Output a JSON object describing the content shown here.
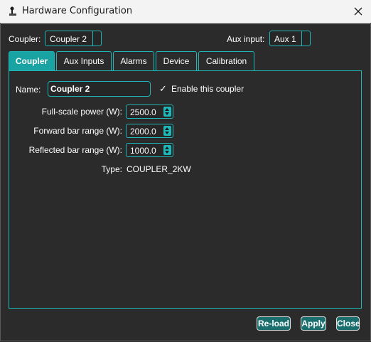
{
  "window": {
    "title": "Hardware Configuration",
    "app_icon": "app-icon",
    "close_icon": "close-icon"
  },
  "header": {
    "coupler_label": "Coupler:",
    "coupler_value": "Coupler 2",
    "aux_label": "Aux input:",
    "aux_value": "Aux 1"
  },
  "tabs": [
    {
      "label": "Coupler",
      "active": true
    },
    {
      "label": "Aux Inputs"
    },
    {
      "label": "Alarms"
    },
    {
      "label": "Device"
    },
    {
      "label": "Calibration"
    }
  ],
  "coupler_tab": {
    "name_label": "Name:",
    "name_value": "Coupler 2",
    "enable_mark": "✓",
    "enable_label": "Enable this coupler",
    "enable_checked": true,
    "full_scale_label": "Full-scale power (W):",
    "full_scale_value": "2500.0",
    "forward_label": "Forward bar range (W):",
    "forward_value": "2000.0",
    "reflected_label": "Reflected bar range (W):",
    "reflected_value": "1000.0",
    "type_label": "Type:",
    "type_value": "COUPLER_2KW"
  },
  "buttons": {
    "reload": "Re-load",
    "apply": "Apply",
    "close": "Close"
  },
  "colors": {
    "accent": "#1fb7b7",
    "active_tab": "#19a3a3",
    "button_bg": "#1a6e6e",
    "background": "#2b2b2b"
  }
}
